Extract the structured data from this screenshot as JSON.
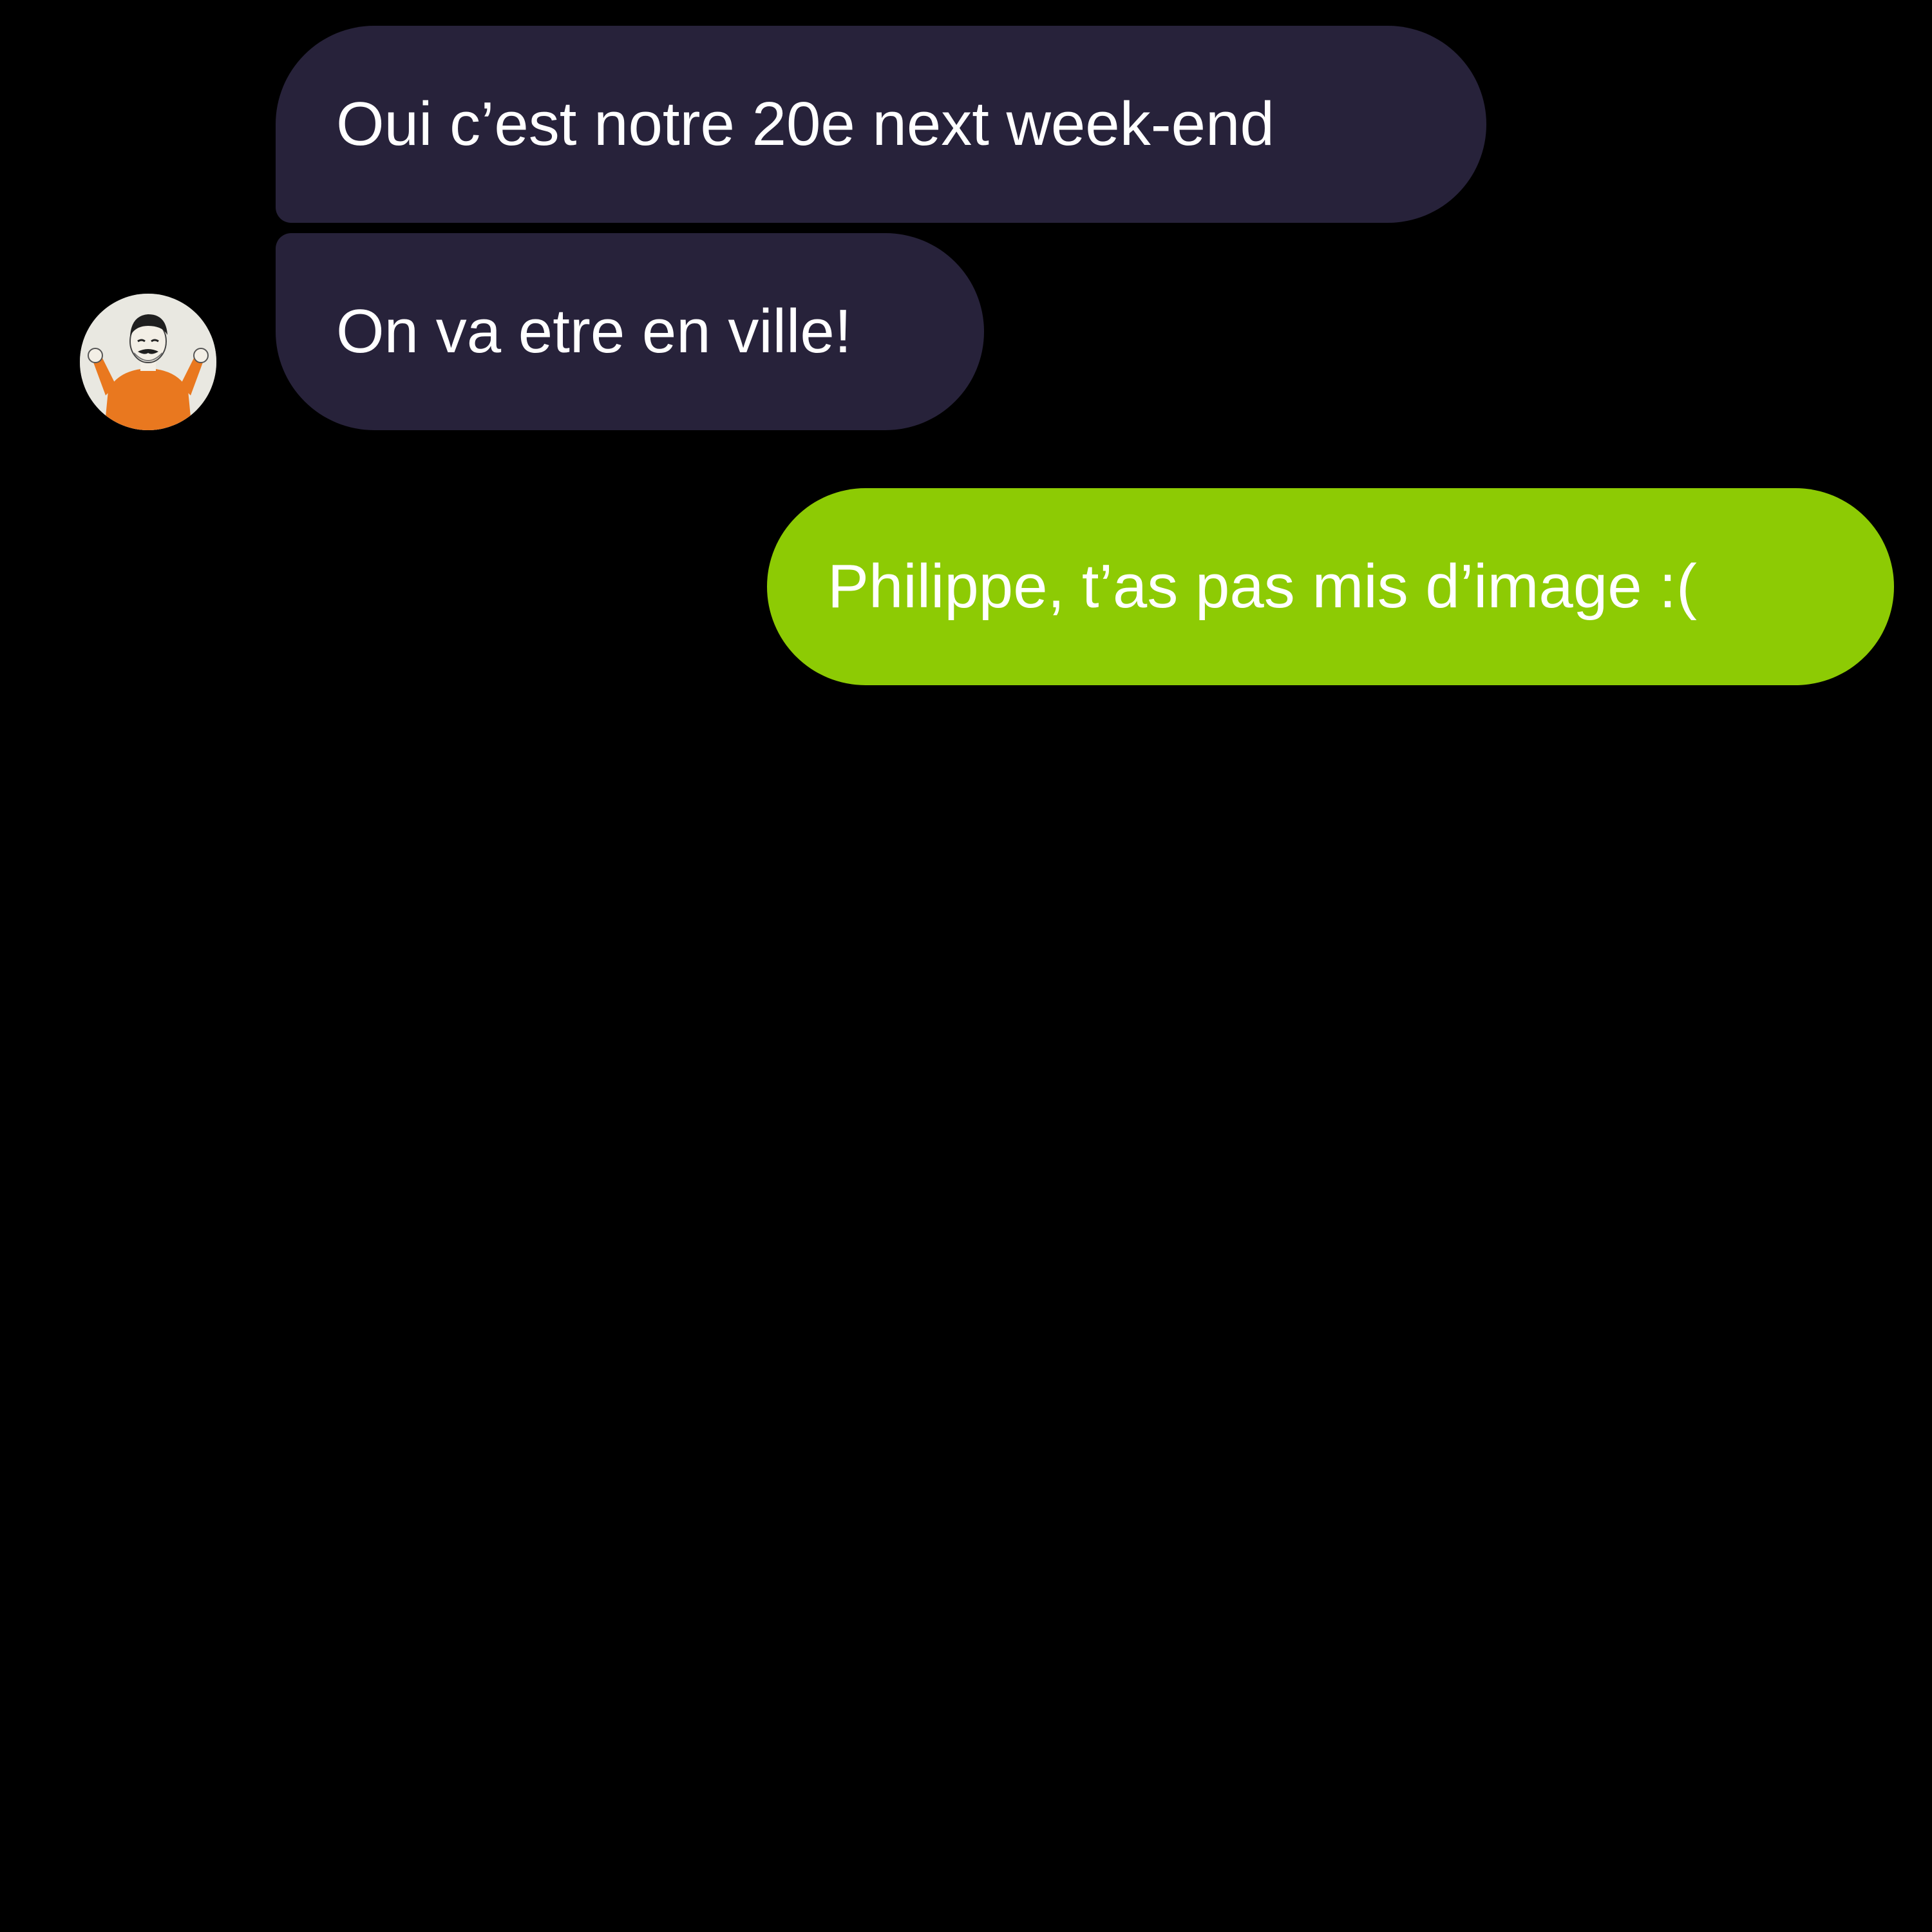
{
  "conversation": {
    "messages": [
      {
        "direction": "incoming",
        "text": "Oui c’est notre 20e next week-end"
      },
      {
        "direction": "incoming",
        "text": "On va etre en ville!"
      },
      {
        "direction": "outgoing",
        "text": "Philippe, t’as pas mis d’image :("
      }
    ],
    "avatar": {
      "icon": "person-shrugging-avatar-icon"
    }
  },
  "colors": {
    "background": "#000000",
    "incoming_bubble": "#27223a",
    "outgoing_bubble": "#8dcb04",
    "text": "#ffffff"
  }
}
